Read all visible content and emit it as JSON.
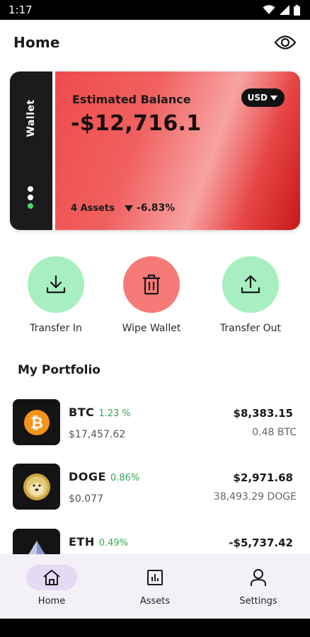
{
  "status_bar": {
    "time": "1:17"
  },
  "header": {
    "title": "Home",
    "visibility_icon": "eye-icon"
  },
  "wallet_card": {
    "side_label": "Wallet",
    "balance_label": "Estimated Balance",
    "balance_value": "-$12,716.1",
    "currency": "USD",
    "assets_count": "4 Assets",
    "change": "-6.83%",
    "colors": {
      "gradient_start": "#ef4b4b",
      "gradient_end": "#c81818",
      "side": "#1b1b1d"
    }
  },
  "actions": [
    {
      "label": "Transfer In",
      "icon": "download-icon",
      "color": "#a7efc0"
    },
    {
      "label": "Wipe Wallet",
      "icon": "trash-icon",
      "color": "#f57a78"
    },
    {
      "label": "Transfer Out",
      "icon": "upload-icon",
      "color": "#a7efc0"
    }
  ],
  "portfolio": {
    "title": "My Portfolio",
    "items": [
      {
        "symbol": "BTC",
        "change": "1.23 %",
        "price": "$17,457.62",
        "value": "$8,383.15",
        "amount": "0.48 BTC",
        "icon": "bitcoin-icon"
      },
      {
        "symbol": "DOGE",
        "change": "0.86%",
        "price": "$0.077",
        "value": "$2,971.68",
        "amount": "38,493.29  DOGE",
        "icon": "dogecoin-icon"
      },
      {
        "symbol": "ETH",
        "change": "0.49%",
        "price": "",
        "value": "-$5,737.42",
        "amount": "",
        "icon": "ethereum-icon"
      }
    ]
  },
  "bottom_nav": {
    "items": [
      {
        "label": "Home",
        "icon": "home-icon",
        "active": true
      },
      {
        "label": "Assets",
        "icon": "chart-icon",
        "active": false
      },
      {
        "label": "Settings",
        "icon": "person-icon",
        "active": false
      }
    ]
  },
  "accent_colors": {
    "positive": "#34a853",
    "nav_active": "#e6d9f4",
    "nav_bg": "#f4f0f8"
  }
}
